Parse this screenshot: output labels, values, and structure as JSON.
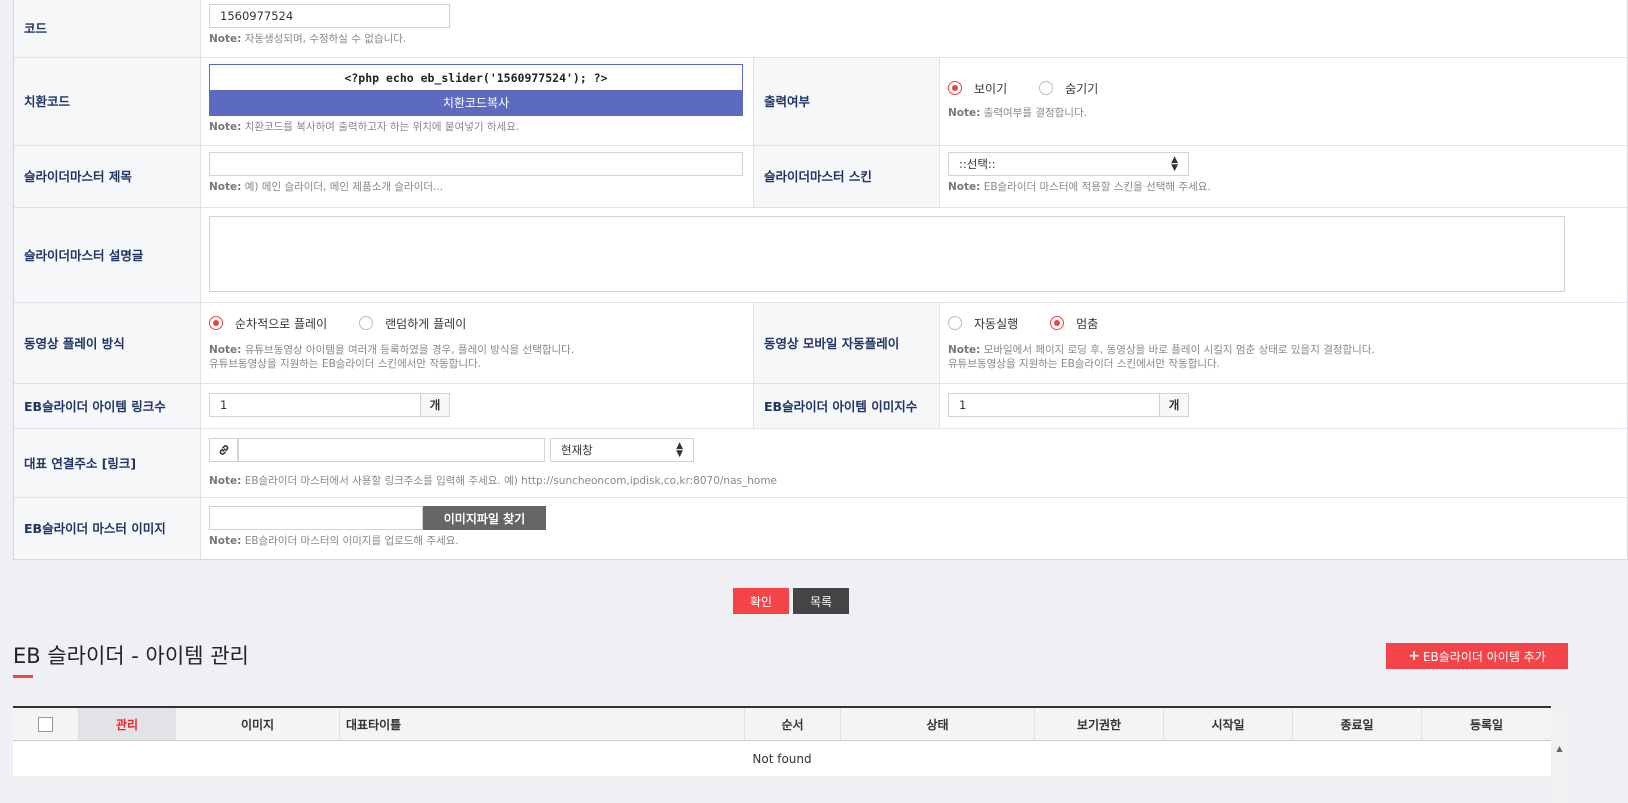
{
  "form": {
    "code": {
      "label": "코드",
      "value": "1560977524",
      "note_prefix": "Note:",
      "note": "자동생성되며, 수정하실 수 없습니다."
    },
    "replace_code": {
      "label": "치환코드",
      "code": "<?php echo eb_slider('1560977524'); ?>",
      "copy_button": "치환코드복사",
      "note_prefix": "Note:",
      "note": "치환코드를 복사하여 출력하고자 하는 위치에 붙여넣기 하세요."
    },
    "output": {
      "label": "출력여부",
      "options": [
        "보이기",
        "숨기기"
      ],
      "note_prefix": "Note:",
      "note": "출력여부를 결정합니다."
    },
    "title": {
      "label": "슬라이더마스터 제목",
      "value": "",
      "note_prefix": "Note:",
      "note": "예) 메인 슬라이더, 메인 제품소개 슬라이더..."
    },
    "skin": {
      "label": "슬라이더마스터 스킨",
      "selected": "::선택::",
      "note_prefix": "Note:",
      "note": "EB슬라이더 마스터에 적용할 스킨을 선택해 주세요."
    },
    "description": {
      "label": "슬라이더마스터 설명글",
      "value": ""
    },
    "video_play": {
      "label": "동영상 플레이 방식",
      "options": [
        "순차적으로 플레이",
        "랜덤하게 플레이"
      ],
      "note_prefix": "Note:",
      "note1": "유튜브동영상 아이템을 여러개 등록하였을 경우, 플레이 방식을 선택합니다.",
      "note2": "유튜브동영상을 지원하는 EB슬라이더 스킨에서만 작동합니다."
    },
    "mobile_autoplay": {
      "label": "동영상 모바일 자동플레이",
      "options": [
        "자동실행",
        "멈춤"
      ],
      "note_prefix": "Note:",
      "note1": "모바일에서 페이지 로딩 후, 동영상을 바로 플레이 시킬지 멈춘 상태로 있을지 결정합니다.",
      "note2": "유튜브동영상을 지원하는 EB슬라이더 스킨에서만 작동합니다."
    },
    "link_count": {
      "label": "EB슬라이더 아이템 링크수",
      "value": "1",
      "unit": "개"
    },
    "image_count": {
      "label": "EB슬라이더 아이템 이미지수",
      "value": "1",
      "unit": "개"
    },
    "link": {
      "label": "대표 연결주소 [링크]",
      "value": "",
      "target": "현재창",
      "note_prefix": "Note:",
      "note": "EB슬라이더 마스터에서 사용할 링크주소를 입력해 주세요. 예) http://suncheoncom,ipdisk,co,kr:8070/nas_home"
    },
    "master_image": {
      "label": "EB슬라이더 마스터 이미지",
      "file_button": "이미지파일 찾기",
      "note_prefix": "Note:",
      "note": "EB슬라이더 마스터의 이미지를 업로드해 주세요."
    }
  },
  "actions": {
    "confirm": "확인",
    "list": "목록"
  },
  "items_section": {
    "title": "EB 슬라이더 - 아이템 관리",
    "add_button": "EB슬라이더 아이템 추가",
    "columns": [
      "관리",
      "이미지",
      "대표타이틀",
      "순서",
      "상태",
      "보기권한",
      "시작일",
      "종료일",
      "등록일"
    ],
    "empty": "Not found"
  },
  "colors": {
    "accent": "#f44449",
    "copy_button": "#5c6bc0",
    "label": "#1f3563"
  }
}
